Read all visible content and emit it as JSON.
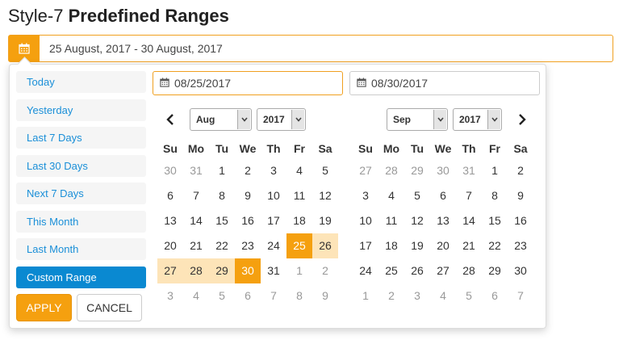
{
  "title": {
    "prefix": "Style-7",
    "bold": "Predefined Ranges"
  },
  "range_input": {
    "value": "25 August, 2017 - 30 August, 2017",
    "icon": "calendar-icon"
  },
  "ranges": [
    {
      "label": "Today",
      "active": false
    },
    {
      "label": "Yesterday",
      "active": false
    },
    {
      "label": "Last 7 Days",
      "active": false
    },
    {
      "label": "Last 30 Days",
      "active": false
    },
    {
      "label": "Next 7 Days",
      "active": false
    },
    {
      "label": "This Month",
      "active": false
    },
    {
      "label": "Last Month",
      "active": false
    },
    {
      "label": "Custom Range",
      "active": true
    }
  ],
  "buttons": {
    "apply": "APPLY",
    "cancel": "CANCEL"
  },
  "start_input": "08/25/2017",
  "end_input": "08/30/2017",
  "dow": [
    "Su",
    "Mo",
    "Tu",
    "We",
    "Th",
    "Fr",
    "Sa"
  ],
  "left_calendar": {
    "month": "Aug",
    "year": "2017",
    "weeks": [
      [
        {
          "d": "30",
          "s": "off"
        },
        {
          "d": "31",
          "s": "off"
        },
        {
          "d": "1",
          "s": ""
        },
        {
          "d": "2",
          "s": ""
        },
        {
          "d": "3",
          "s": ""
        },
        {
          "d": "4",
          "s": ""
        },
        {
          "d": "5",
          "s": ""
        }
      ],
      [
        {
          "d": "6",
          "s": ""
        },
        {
          "d": "7",
          "s": ""
        },
        {
          "d": "8",
          "s": ""
        },
        {
          "d": "9",
          "s": ""
        },
        {
          "d": "10",
          "s": ""
        },
        {
          "d": "11",
          "s": ""
        },
        {
          "d": "12",
          "s": ""
        }
      ],
      [
        {
          "d": "13",
          "s": ""
        },
        {
          "d": "14",
          "s": ""
        },
        {
          "d": "15",
          "s": ""
        },
        {
          "d": "16",
          "s": ""
        },
        {
          "d": "17",
          "s": ""
        },
        {
          "d": "18",
          "s": ""
        },
        {
          "d": "19",
          "s": ""
        }
      ],
      [
        {
          "d": "20",
          "s": ""
        },
        {
          "d": "21",
          "s": ""
        },
        {
          "d": "22",
          "s": ""
        },
        {
          "d": "23",
          "s": ""
        },
        {
          "d": "24",
          "s": ""
        },
        {
          "d": "25",
          "s": "endpoint"
        },
        {
          "d": "26",
          "s": "in-range"
        }
      ],
      [
        {
          "d": "27",
          "s": "in-range"
        },
        {
          "d": "28",
          "s": "in-range"
        },
        {
          "d": "29",
          "s": "in-range"
        },
        {
          "d": "30",
          "s": "endpoint"
        },
        {
          "d": "31",
          "s": ""
        },
        {
          "d": "1",
          "s": "off"
        },
        {
          "d": "2",
          "s": "off"
        }
      ],
      [
        {
          "d": "3",
          "s": "off"
        },
        {
          "d": "4",
          "s": "off"
        },
        {
          "d": "5",
          "s": "off"
        },
        {
          "d": "6",
          "s": "off"
        },
        {
          "d": "7",
          "s": "off"
        },
        {
          "d": "8",
          "s": "off"
        },
        {
          "d": "9",
          "s": "off"
        }
      ]
    ]
  },
  "right_calendar": {
    "month": "Sep",
    "year": "2017",
    "weeks": [
      [
        {
          "d": "27",
          "s": "off"
        },
        {
          "d": "28",
          "s": "off"
        },
        {
          "d": "29",
          "s": "off"
        },
        {
          "d": "30",
          "s": "off"
        },
        {
          "d": "31",
          "s": "off"
        },
        {
          "d": "1",
          "s": ""
        },
        {
          "d": "2",
          "s": ""
        }
      ],
      [
        {
          "d": "3",
          "s": ""
        },
        {
          "d": "4",
          "s": ""
        },
        {
          "d": "5",
          "s": ""
        },
        {
          "d": "6",
          "s": ""
        },
        {
          "d": "7",
          "s": ""
        },
        {
          "d": "8",
          "s": ""
        },
        {
          "d": "9",
          "s": ""
        }
      ],
      [
        {
          "d": "10",
          "s": ""
        },
        {
          "d": "11",
          "s": ""
        },
        {
          "d": "12",
          "s": ""
        },
        {
          "d": "13",
          "s": ""
        },
        {
          "d": "14",
          "s": ""
        },
        {
          "d": "15",
          "s": ""
        },
        {
          "d": "16",
          "s": ""
        }
      ],
      [
        {
          "d": "17",
          "s": ""
        },
        {
          "d": "18",
          "s": ""
        },
        {
          "d": "19",
          "s": ""
        },
        {
          "d": "20",
          "s": ""
        },
        {
          "d": "21",
          "s": ""
        },
        {
          "d": "22",
          "s": ""
        },
        {
          "d": "23",
          "s": ""
        }
      ],
      [
        {
          "d": "24",
          "s": ""
        },
        {
          "d": "25",
          "s": ""
        },
        {
          "d": "26",
          "s": ""
        },
        {
          "d": "27",
          "s": ""
        },
        {
          "d": "28",
          "s": ""
        },
        {
          "d": "29",
          "s": ""
        },
        {
          "d": "30",
          "s": ""
        }
      ],
      [
        {
          "d": "1",
          "s": "off"
        },
        {
          "d": "2",
          "s": "off"
        },
        {
          "d": "3",
          "s": "off"
        },
        {
          "d": "4",
          "s": "off"
        },
        {
          "d": "5",
          "s": "off"
        },
        {
          "d": "6",
          "s": "off"
        },
        {
          "d": "7",
          "s": "off"
        }
      ]
    ]
  },
  "colors": {
    "accent": "#f5a00f",
    "range_fill": "#fde4b8",
    "link": "#1a8fd8",
    "active_range": "#0a89d1"
  }
}
